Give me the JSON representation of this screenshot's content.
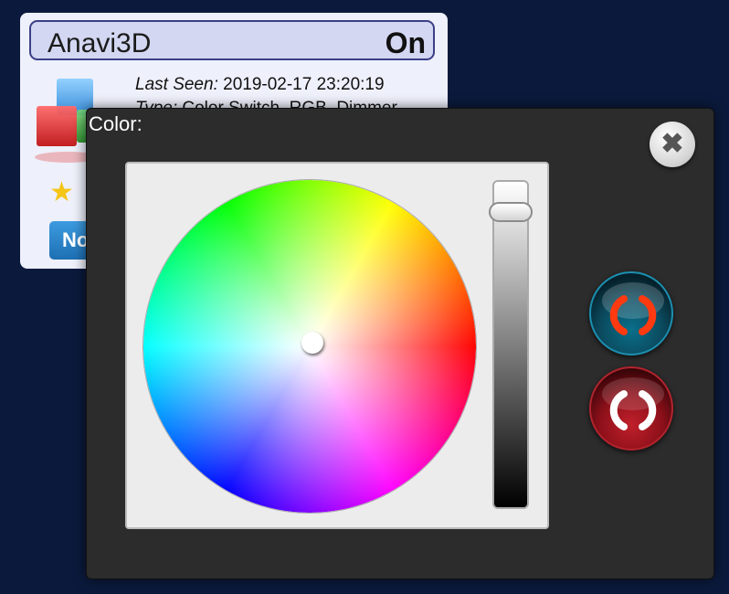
{
  "device": {
    "name": "Anavi3D",
    "state": "On",
    "last_seen_label": "Last Seen:",
    "last_seen_value": "2019-02-17 23:20:19",
    "type_label": "Type:",
    "type_value": "Color Switch, RGB, Dimmer",
    "favorite_icon": "star-icon",
    "button_label": "No"
  },
  "dialog": {
    "title": "Color:",
    "close_icon": "close-icon",
    "on_icon": "power-on-icon",
    "off_icon": "power-off-icon"
  },
  "picker": {
    "brightness_level": 0.93
  },
  "colors": {
    "page_background": "#0b1a3c",
    "dialog_background": "#2c2c2c",
    "on_button": "#1c8fb0",
    "off_button": "#b3232d",
    "power_glyph_on": "#ff3a10",
    "power_glyph_off": "#ffffff"
  }
}
